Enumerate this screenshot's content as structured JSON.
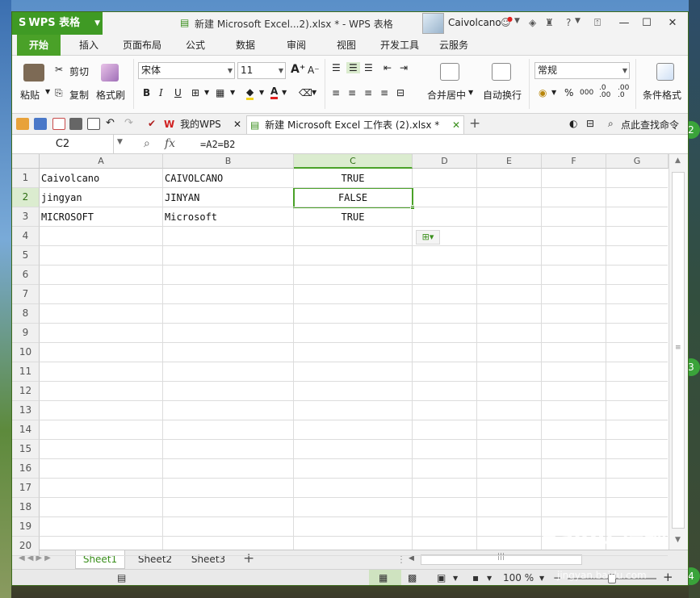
{
  "app": {
    "logo": "WPS 表格",
    "window_title": "新建 Microsoft Excel...2).xlsx * - WPS 表格",
    "user_name": "Caivolcano",
    "accent": "#4aa128"
  },
  "menu": [
    "开始",
    "插入",
    "页面布局",
    "公式",
    "数据",
    "审阅",
    "视图",
    "开发工具",
    "云服务"
  ],
  "ribbon": {
    "paste": "粘贴",
    "cut": "剪切",
    "copy": "复制",
    "format_painter": "格式刷",
    "font_name": "宋体",
    "font_size": "11",
    "merge_center": "合并居中",
    "wrap_text": "自动换行",
    "number_format": "常规",
    "percent": "%",
    "comma": "000",
    "conditional_format": "条件格式"
  },
  "tabs": {
    "mywps": "我的WPS",
    "file": "新建 Microsoft Excel 工作表 (2).xlsx *",
    "search": "点此查找命令"
  },
  "formula_bar": {
    "name_box": "C2",
    "fx": "fx",
    "formula": "=A2=B2"
  },
  "columns": [
    "A",
    "B",
    "C",
    "D",
    "E",
    "F",
    "G"
  ],
  "rows": [
    "1",
    "2",
    "3",
    "4",
    "5",
    "6",
    "7",
    "8",
    "9",
    "10",
    "11",
    "12",
    "13",
    "14",
    "15",
    "16",
    "17",
    "18",
    "19",
    "20"
  ],
  "cells": [
    [
      "Caivolcano",
      "CAIVOLCANO",
      "TRUE"
    ],
    [
      "jingyan",
      "JINYAN",
      "FALSE"
    ],
    [
      "MICROSOFT",
      "Microsoft",
      "TRUE"
    ]
  ],
  "selected_cell": "C2",
  "sheets": [
    "Sheet1",
    "Sheet2",
    "Sheet3"
  ],
  "active_sheet": "Sheet1",
  "status": {
    "zoom": "100 %"
  },
  "watermark": {
    "brand": "Baidu 经验",
    "url": "jingyan.baidu.com"
  },
  "desktop_badges": [
    "2",
    "3",
    "4"
  ]
}
